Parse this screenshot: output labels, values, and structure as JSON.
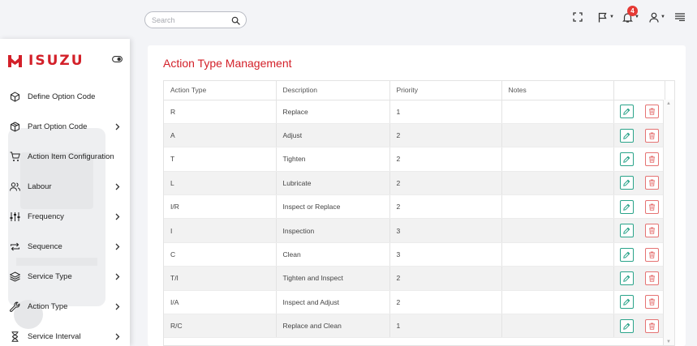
{
  "search": {
    "placeholder": "Search",
    "value": ""
  },
  "header": {
    "notification_count": "4"
  },
  "brand": {
    "name": "ISUZU",
    "color": "#d32029"
  },
  "sidebar": {
    "items": [
      {
        "label": "Define Option Code",
        "icon": "cube-icon",
        "has_submenu": false
      },
      {
        "label": "Part Option Code",
        "icon": "box-icon",
        "has_submenu": true
      },
      {
        "label": "Action Item Configuration",
        "icon": "cart-icon",
        "has_submenu": false
      },
      {
        "label": "Labour",
        "icon": "users-icon",
        "has_submenu": true
      },
      {
        "label": "Frequency",
        "icon": "sliders-icon",
        "has_submenu": true
      },
      {
        "label": "Sequence",
        "icon": "repeat-icon",
        "has_submenu": true
      },
      {
        "label": "Service Type",
        "icon": "layers-icon",
        "has_submenu": true
      },
      {
        "label": "Action Type",
        "icon": "wrench-icon",
        "has_submenu": true
      },
      {
        "label": "Service Interval",
        "icon": "hourglass-icon",
        "has_submenu": true
      }
    ]
  },
  "main": {
    "title": "Action Type Management",
    "columns": [
      "Action Type",
      "Description",
      "Priority",
      "Notes"
    ],
    "rows": [
      {
        "type": "R",
        "description": "Replace",
        "priority": "1",
        "notes": ""
      },
      {
        "type": "A",
        "description": "Adjust",
        "priority": "2",
        "notes": ""
      },
      {
        "type": "T",
        "description": "Tighten",
        "priority": "2",
        "notes": ""
      },
      {
        "type": "L",
        "description": "Lubricate",
        "priority": "2",
        "notes": ""
      },
      {
        "type": "I/R",
        "description": "Inspect or Replace",
        "priority": "2",
        "notes": ""
      },
      {
        "type": "I",
        "description": "Inspection",
        "priority": "3",
        "notes": ""
      },
      {
        "type": "C",
        "description": "Clean",
        "priority": "3",
        "notes": ""
      },
      {
        "type": "T/I",
        "description": "Tighten and Inspect",
        "priority": "2",
        "notes": ""
      },
      {
        "type": "I/A",
        "description": "Inspect and Adjust",
        "priority": "2",
        "notes": ""
      },
      {
        "type": "R/C",
        "description": "Replace and Clean",
        "priority": "1",
        "notes": ""
      }
    ]
  },
  "colors": {
    "accent": "#d32029",
    "edit": "#2aa48a",
    "delete": "#e57373"
  }
}
